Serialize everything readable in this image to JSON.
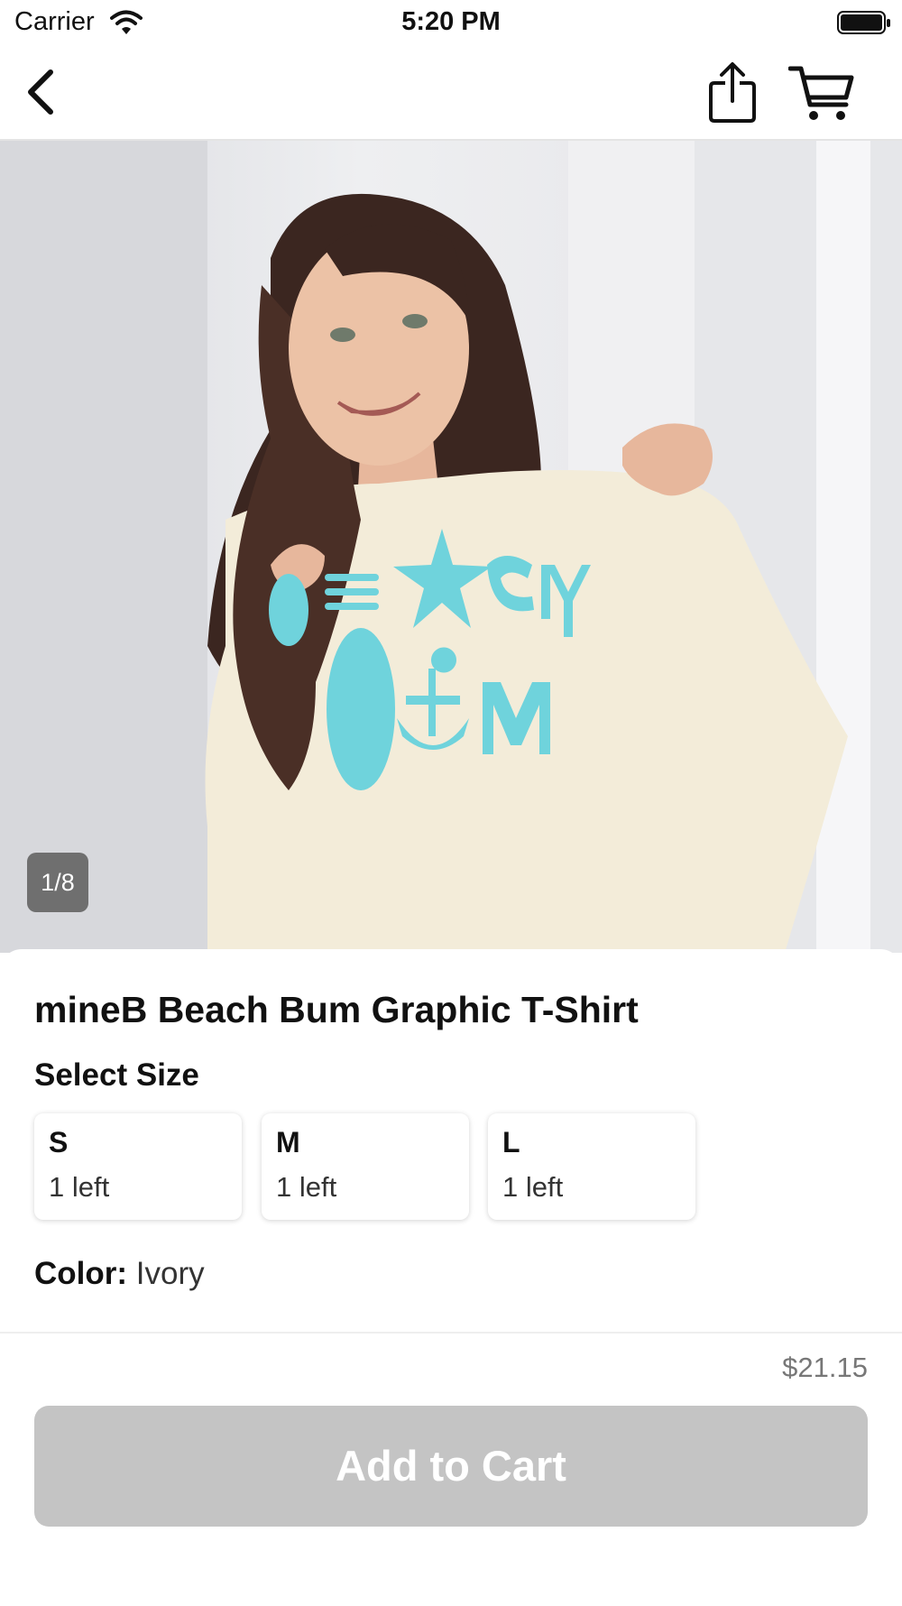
{
  "status_bar": {
    "carrier": "Carrier",
    "time": "5:20 PM"
  },
  "nav": {
    "back_icon": "chevron-left-icon",
    "share_icon": "share-icon",
    "cart_icon": "cart-icon"
  },
  "gallery": {
    "indicator": "1/8",
    "current_index": 1,
    "total_images": 8
  },
  "product": {
    "title": "mineB Beach Bum Graphic T-Shirt",
    "size_heading": "Select Size",
    "sizes": [
      {
        "label": "S",
        "stock": "1 left"
      },
      {
        "label": "M",
        "stock": "1 left"
      },
      {
        "label": "L",
        "stock": "1 left"
      }
    ],
    "color_label": "Color:",
    "color_value": "Ivory"
  },
  "purchase": {
    "price": "$21.15",
    "add_to_cart_label": "Add to Cart"
  },
  "colors": {
    "button_disabled": "#c4c4c4",
    "text_primary": "#111111",
    "text_secondary": "#777777",
    "shirt": "#f3ecd9",
    "graphic_print": "#6fd3dc"
  }
}
